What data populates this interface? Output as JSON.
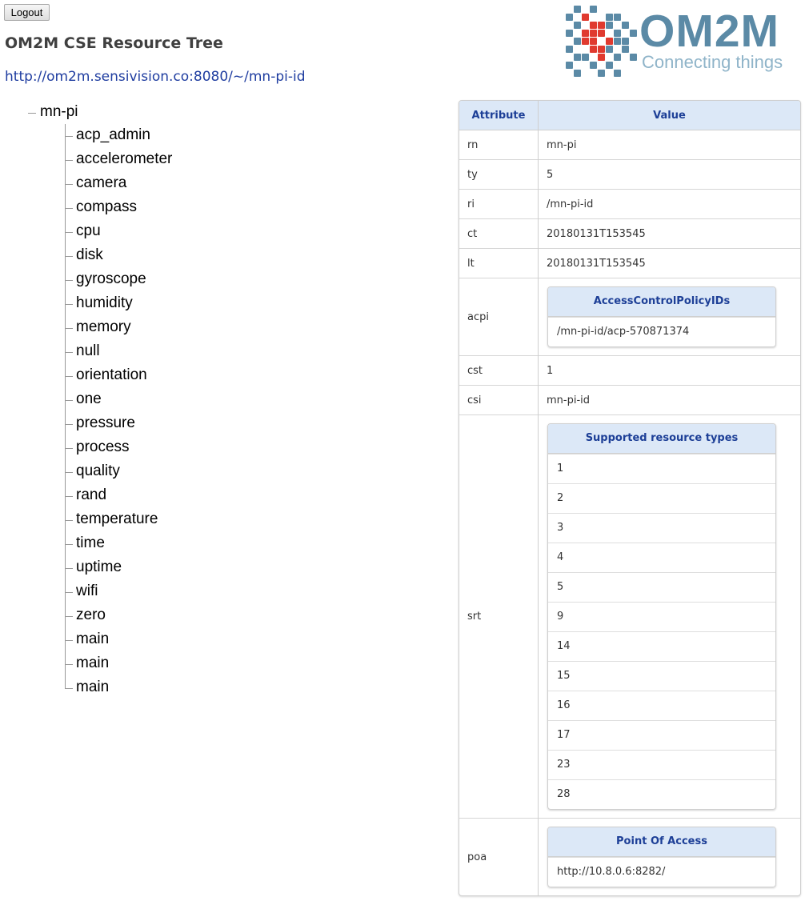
{
  "logout_label": "Logout",
  "page_title": "OM2M CSE Resource Tree",
  "cse_url": "http://om2m.sensivision.co:8080/~/mn-pi-id",
  "logo": {
    "word": "OM2M",
    "tagline": "Connecting things"
  },
  "tree": {
    "root": "mn-pi",
    "children": [
      "acp_admin",
      "accelerometer",
      "camera",
      "compass",
      "cpu",
      "disk",
      "gyroscope",
      "humidity",
      "memory",
      "null",
      "orientation",
      "one",
      "pressure",
      "process",
      "quality",
      "rand",
      "temperature",
      "time",
      "uptime",
      "wifi",
      "zero",
      "main",
      "main",
      "main"
    ]
  },
  "table": {
    "header_attribute": "Attribute",
    "header_value": "Value",
    "rows": [
      {
        "attr": "rn",
        "value": "mn-pi"
      },
      {
        "attr": "ty",
        "value": "5"
      },
      {
        "attr": "ri",
        "value": "/mn-pi-id"
      },
      {
        "attr": "ct",
        "value": "20180131T153545"
      },
      {
        "attr": "lt",
        "value": "20180131T153545"
      }
    ],
    "acpi": {
      "attr": "acpi",
      "header": "AccessControlPolicyIDs",
      "items": [
        "/mn-pi-id/acp-570871374"
      ]
    },
    "rows2": [
      {
        "attr": "cst",
        "value": "1"
      },
      {
        "attr": "csi",
        "value": "mn-pi-id"
      }
    ],
    "srt": {
      "attr": "srt",
      "header": "Supported resource types",
      "items": [
        "1",
        "2",
        "3",
        "4",
        "5",
        "9",
        "14",
        "15",
        "16",
        "17",
        "23",
        "28"
      ]
    },
    "poa": {
      "attr": "poa",
      "header": "Point Of Access",
      "items": [
        "http://10.8.0.6:8282/"
      ]
    }
  },
  "colors": {
    "header_bg": "#dce8f7",
    "header_text": "#1d3f97",
    "link": "#1f3da0",
    "logo_blue": "#5b8aa6",
    "logo_red": "#e03a2f"
  }
}
